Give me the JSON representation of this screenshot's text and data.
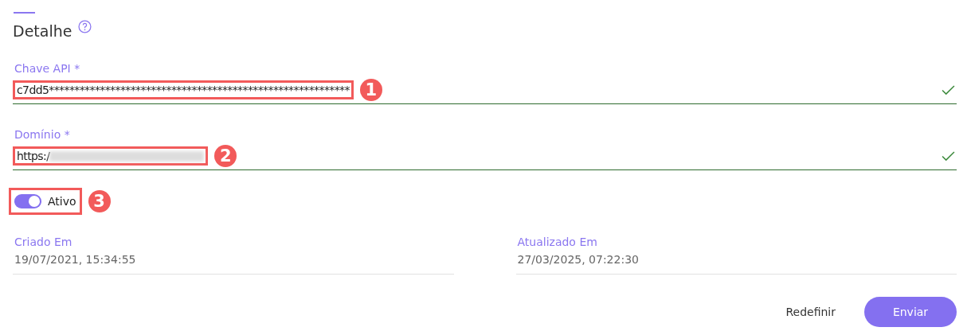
{
  "section": {
    "title": "Detalhe"
  },
  "fields": [
    {
      "label": "Chave API *",
      "value": "c7dd5***********************************************************",
      "valid": true,
      "callout": "1"
    },
    {
      "label": "Domínio *",
      "value": "https:/",
      "redacted": true,
      "valid": true,
      "callout": "2"
    }
  ],
  "toggle": {
    "label": "Ativo",
    "on": true,
    "callout": "3"
  },
  "info": [
    {
      "label": "Criado Em",
      "value": "19/07/2021, 15:34:55"
    },
    {
      "label": "Atualizado Em",
      "value": "27/03/2025, 07:22:30"
    }
  ],
  "buttons": [
    {
      "label": "Redefinir",
      "kind": "text"
    },
    {
      "label": "Enviar",
      "kind": "primary"
    }
  ]
}
